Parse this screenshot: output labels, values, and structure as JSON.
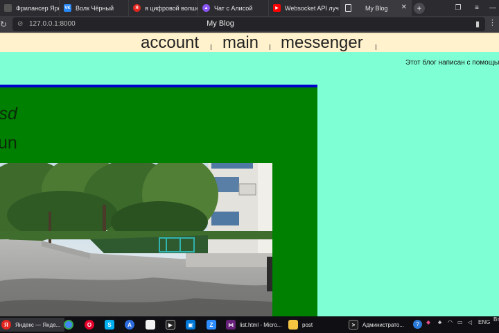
{
  "browser": {
    "tabs": [
      {
        "title": "Фрилансер Ярослав",
        "favicon": "tab-favicon-freelance",
        "color": "#3a3a3f",
        "glyph": ""
      },
      {
        "title": "Волк Чёрный",
        "favicon": "vk-icon",
        "color": "#2787f5",
        "glyph": "VK"
      },
      {
        "title": "я цифровой волшеб",
        "favicon": "yandex-icon",
        "color": "#e52620",
        "glyph": "Я"
      },
      {
        "title": "Чат с Алисой",
        "favicon": "alice-icon",
        "color": "#8a55f5",
        "glyph": "▲"
      },
      {
        "title": "Websocket API луч",
        "favicon": "youtube-icon",
        "color": "#ff0000",
        "glyph": "▶"
      },
      {
        "title": "My Blog",
        "favicon": "document-icon",
        "color": "#3a3a3f",
        "glyph": ""
      }
    ],
    "active_tab_close": "✕",
    "new_tab": "+",
    "url": "127.0.0.1:8000",
    "page_title": "My Blog"
  },
  "page": {
    "nav": {
      "account": "account",
      "main": "main",
      "messenger": "messenger"
    },
    "marquee": "Этот блог написан с помощью",
    "post": {
      "title": "csd",
      "subtitle": "fun"
    },
    "colors": {
      "background": "#7fffd4",
      "nav_bg": "#fff2cc",
      "post_bg": "#008000",
      "post_border": "#0000cc"
    }
  },
  "taskbar": {
    "items": [
      {
        "label": "Яндекс — Янде...",
        "icon": "yandex-browser-icon"
      },
      {
        "label": "",
        "icon": "chrome-icon"
      },
      {
        "label": "",
        "icon": "opera-icon"
      },
      {
        "label": "",
        "icon": "skype-icon"
      },
      {
        "label": "",
        "icon": "app-a-icon"
      },
      {
        "label": "",
        "icon": "file-icon"
      },
      {
        "label": "",
        "icon": "media-player-icon"
      },
      {
        "label": "",
        "icon": "store-icon"
      },
      {
        "label": "",
        "icon": "zoom-icon"
      },
      {
        "label": "list.html - Micro...",
        "icon": "visual-studio-icon"
      },
      {
        "label": "post",
        "icon": "folder-icon"
      },
      {
        "label": "Администрато...",
        "icon": "terminal-icon"
      }
    ],
    "language": "ENG",
    "clock_fragment": "Вт"
  }
}
